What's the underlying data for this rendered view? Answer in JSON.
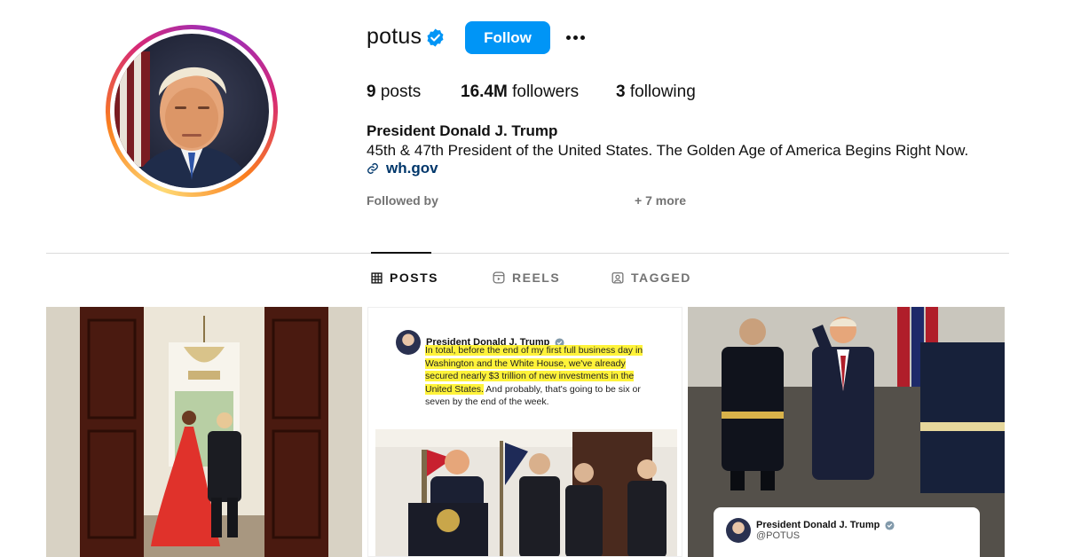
{
  "profile": {
    "username": "potus",
    "verified": true,
    "follow_label": "Follow",
    "more_icon": "more-options-icon",
    "stats": {
      "posts_count": "9",
      "posts_label": "posts",
      "followers_count": "16.4M",
      "followers_label": "followers",
      "following_count": "3",
      "following_label": "following"
    },
    "full_name": "President Donald J. Trump",
    "bio": "45th & 47th President of the United States. The Golden Age of America Begins Right Now.",
    "link": "wh.gov",
    "followed_by_label": "Followed by",
    "followed_more": "+ 7 more"
  },
  "tabs": [
    {
      "label": "POSTS",
      "icon": "grid-icon",
      "active": true
    },
    {
      "label": "REELS",
      "icon": "reels-icon",
      "active": false
    },
    {
      "label": "TAGGED",
      "icon": "tagged-icon",
      "active": false
    }
  ],
  "posts": {
    "post2": {
      "author": "President Donald J. Trump",
      "text_highlighted": "In total, before the end of my first full business day in Washington and the White House, we've already secured nearly $3 trillion of new investments in the United States.",
      "text_rest": " And probably, that's going to be six or seven by the end of the week."
    },
    "post3": {
      "author": "President Donald J. Trump",
      "handle": "@POTUS"
    }
  },
  "colors": {
    "accent": "#0095f6",
    "link": "#00376b",
    "muted": "#737373",
    "divider": "#dbdbdb",
    "highlight": "#fff33a"
  }
}
